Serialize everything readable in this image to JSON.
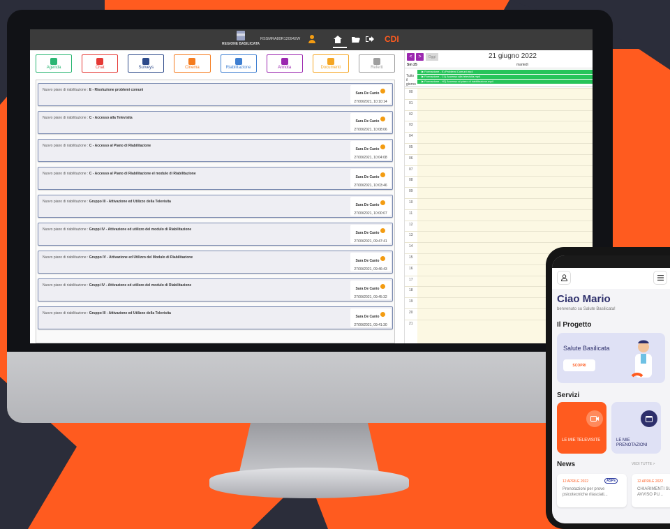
{
  "colors": {
    "accent": "#ff5b1f",
    "topbar": "#3b3b3b",
    "calendar_nav": "#9b27af",
    "event_green": "#27c45a",
    "calendar_bg": "#fcf8e3",
    "phone_brand": "#2d2f6b"
  },
  "app": {
    "header": {
      "region_name": "REGIONE BASILICATA",
      "user_code": "RSSMRA80R120942W",
      "brand": "CDI"
    },
    "tiles": [
      {
        "label": "Agenda",
        "color": "#2bb673",
        "icon": "calendar-icon"
      },
      {
        "label": "Chat",
        "color": "#e53935",
        "icon": "chat-icon"
      },
      {
        "label": "Surveys",
        "color": "#2d4a8a",
        "icon": "chart-icon"
      },
      {
        "label": "Cinema",
        "color": "#f57c1f",
        "icon": "cinema-icon"
      },
      {
        "label": "Riabilitazione",
        "color": "#3f7fd1",
        "icon": "document-icon"
      },
      {
        "label": "Annota",
        "color": "#9b27af",
        "icon": "note-icon"
      },
      {
        "label": "Documenti",
        "color": "#f5a623",
        "icon": "folder-icon"
      },
      {
        "label": "Referti",
        "color": "#9e9e9e",
        "icon": "report-icon"
      }
    ],
    "items": [
      {
        "prefix": "Nuovo piano di riabilitazione : ",
        "title": "E - Risoluzione problemi comuni",
        "author": "Sara De Canio",
        "date": "27/09/2021, 10:10:14"
      },
      {
        "prefix": "Nuovo piano di riabilitazione : ",
        "title": "C - Accesso alla Televisita",
        "author": "Sara De Canio",
        "date": "27/09/2021, 10:08:06"
      },
      {
        "prefix": "Nuovo piano di riabilitazione : ",
        "title": "C - Accesso al Piano di Riabilitazione",
        "author": "Sara De Canio",
        "date": "27/09/2021, 10:04:08"
      },
      {
        "prefix": "Nuovo piano di riabilitazione : ",
        "title": "C - Accesso al Piano di Riabilitazione el modulo di Riabilitazione",
        "author": "Sara De Canio",
        "date": "27/09/2021, 10:03:46"
      },
      {
        "prefix": "Nuovo piano di riabilitazione : ",
        "title": "Gruppo III - Attivazione ed Utilizzo della Televisita",
        "author": "Sara De Canio",
        "date": "27/09/2021, 10:00:07"
      },
      {
        "prefix": "Nuovo piano di riabilitazione : ",
        "title": "Gruppi IV - Attivazione ed utilizzo del modulo di Riabilitazione",
        "author": "Sara De Canio",
        "date": "27/09/2021, 09:47:41"
      },
      {
        "prefix": "Nuovo piano di riabilitazione : ",
        "title": "Gruppo IV - Attivazione ed Utilizzo del Modulo di Riabilitazione",
        "author": "Sara De Canio",
        "date": "27/09/2021, 09:46:43"
      },
      {
        "prefix": "Nuovo piano di riabilitazione : ",
        "title": "Gruppi IV - Attivazione ed utilizzo del modulo di Riabilitazione",
        "author": "Sara De Canio",
        "date": "27/09/2021, 09:45:32"
      },
      {
        "prefix": "Nuovo piano di riabilitazione : ",
        "title": "Gruppo III - Attivazione ed Utilizzo della Televisita",
        "author": "Sara De Canio",
        "date": "27/09/2021, 09:41:30"
      }
    ],
    "calendar": {
      "prev": "<",
      "next": ">",
      "today": "Oggi",
      "title": "21 giugno 2022",
      "week_label": "Sm 25",
      "day_label": "martedì",
      "allday_label": "Tutto il giorno",
      "events": [
        "Formazione - E) Problemi Comuni.mp4",
        "Formazione - C1) Accesso alla televisita.mp4",
        "Formazione - H2) Accesso al piano di riabilitazione.mp4"
      ],
      "hours": [
        "00",
        "01",
        "02",
        "03",
        "04",
        "05",
        "06",
        "07",
        "08",
        "09",
        "10",
        "11",
        "12",
        "13",
        "14",
        "15",
        "16",
        "17",
        "18",
        "19",
        "20",
        "21"
      ]
    }
  },
  "phone": {
    "greeting": "Ciao Mario",
    "welcome": "benvenuto su Salute Basilicata!",
    "section_project": "Il Progetto",
    "project_card_title": "Salute Basilicata",
    "project_button": "SCOPRI",
    "section_services": "Servizi",
    "service_1": "LE MIE TELEVISITE",
    "service_2": "LE MIE PRENOTAZIONI",
    "section_news": "News",
    "see_all": "VEDI TUTTE >",
    "news": [
      {
        "date": "12 APRILE 2022",
        "badge": "ASPs",
        "text": "Prenotazioni per prove psicotecniche rilasciati..."
      },
      {
        "date": "12 APRILE 2022",
        "text": "CHIARIMENTI SU AVVISO PU..."
      }
    ]
  }
}
